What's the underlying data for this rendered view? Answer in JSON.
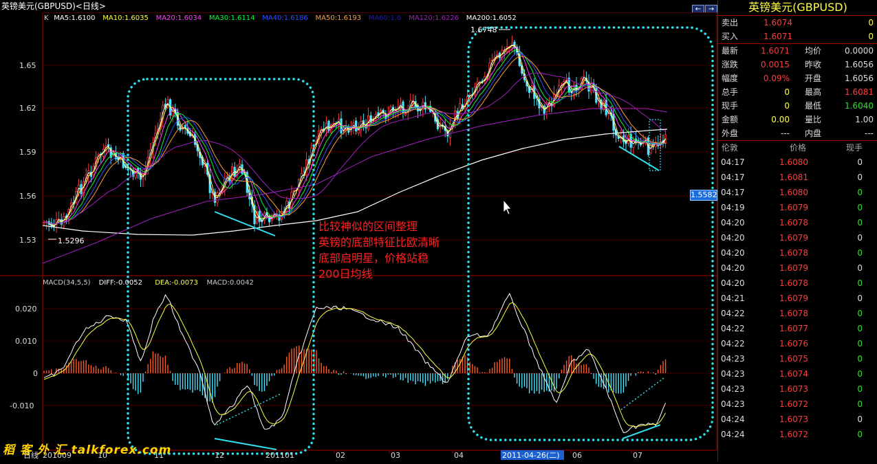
{
  "window": {
    "title": "英镑美元(GBPUSD)<日线>",
    "nav_prev": "←",
    "nav_next": "→"
  },
  "main_chart": {
    "ma_legend": [
      {
        "label": "K",
        "color": "#dddddd"
      },
      {
        "label": "MA5:1.6100",
        "color": "#ffffff"
      },
      {
        "label": "MA10:1.6035",
        "color": "#ffff40"
      },
      {
        "label": "MA20:1.6034",
        "color": "#ff40ff"
      },
      {
        "label": "MA30:1.6114",
        "color": "#00ff40"
      },
      {
        "label": "MA40:1.6186",
        "color": "#3050ff"
      },
      {
        "label": "MA50:1.6193",
        "color": "#ffa030"
      },
      {
        "label": "MA60:1.6",
        "color": "#2020a0"
      },
      {
        "label": "MA120:1.6226",
        "color": "#a020c0"
      },
      {
        "label": "MA200:1.6052",
        "color": "#ffffff"
      }
    ],
    "y_ticks": [
      "1.65",
      "1.62",
      "1.59",
      "1.56",
      "1.53"
    ],
    "high_label": "1.6748",
    "low_label": "1.5296",
    "current_price_tag": "1.5582"
  },
  "macd": {
    "header": [
      {
        "label": "MACD(34,5,5)",
        "color": "#cccccc"
      },
      {
        "label": "DIFF:-0.0052",
        "color": "#ffffff"
      },
      {
        "label": "DEA:-0.0073",
        "color": "#ffff40"
      },
      {
        "label": "MACD:0.0042",
        "color": "#cccccc"
      }
    ],
    "y_ticks": [
      "0.020",
      "0.010",
      "0",
      "-0.010"
    ]
  },
  "x_axis": {
    "labels": [
      "日线",
      "201009",
      "10",
      "11",
      "12",
      "201101",
      "02",
      "03",
      "04",
      "2011-04-26(二)",
      "06",
      "07"
    ]
  },
  "annotation": {
    "lines": [
      "比较神似的区间整理",
      "英镑的底部特征比欧清晰",
      "底部启明星，价格站稳",
      "200日均线"
    ]
  },
  "watermark": "稻 客 外 汇 talkforex.com",
  "quote_panel": {
    "title": "英镑美元(GBPUSD)",
    "rows_top": [
      {
        "label": "卖出",
        "value": "1.6074",
        "value_color": "#ff3c3c",
        "extra": "0"
      },
      {
        "label": "买入",
        "value": "1.6071",
        "value_color": "#ff3c3c",
        "extra": "0"
      }
    ],
    "rows_main": [
      {
        "l1": "最新",
        "v1": "1.6071",
        "c1": "#ff3c3c",
        "l2": "均价",
        "v2": "0.0000",
        "c2": "#dddddd"
      },
      {
        "l1": "涨跌",
        "v1": "0.0015",
        "c1": "#ff3c3c",
        "l2": "昨收",
        "v2": "1.6056",
        "c2": "#dddddd"
      },
      {
        "l1": "幅度",
        "v1": "0.09%",
        "c1": "#ff3c3c",
        "l2": "开盘",
        "v2": "1.6056",
        "c2": "#dddddd"
      },
      {
        "l1": "总手",
        "v1": "0",
        "c1": "#ffff40",
        "l2": "最高",
        "v2": "1.6081",
        "c2": "#ff3c3c"
      },
      {
        "l1": "现手",
        "v1": "0",
        "c1": "#ffff40",
        "l2": "最低",
        "v2": "1.6040",
        "c2": "#2fe02f"
      },
      {
        "l1": "金额",
        "v1": "0.00",
        "c1": "#ffff40",
        "l2": "量比",
        "v2": "1.00",
        "c2": "#dddddd"
      }
    ],
    "row_outer": {
      "l1": "外盘",
      "v1": "---",
      "l2": "内盘",
      "v2": "---"
    },
    "ticks_header": {
      "c1": "伦敦",
      "c2": "价格",
      "c3": "现手"
    },
    "ticks": [
      {
        "time": "04:17",
        "price": "1.6080",
        "vol": "0",
        "vol_color": "#dddddd"
      },
      {
        "time": "04:17",
        "price": "1.6081",
        "vol": "0",
        "vol_color": "#dddddd"
      },
      {
        "time": "04:17",
        "price": "1.6080",
        "vol": "0",
        "vol_color": "#2fe02f"
      },
      {
        "time": "04:19",
        "price": "1.6079",
        "vol": "0",
        "vol_color": "#2fe02f"
      },
      {
        "time": "04:20",
        "price": "1.6078",
        "vol": "0",
        "vol_color": "#2fe02f"
      },
      {
        "time": "04:20",
        "price": "1.6079",
        "vol": "0",
        "vol_color": "#dddddd"
      },
      {
        "time": "04:20",
        "price": "1.6078",
        "vol": "0",
        "vol_color": "#2fe02f"
      },
      {
        "time": "04:20",
        "price": "1.6079",
        "vol": "0",
        "vol_color": "#dddddd"
      },
      {
        "time": "04:20",
        "price": "1.6078",
        "vol": "0",
        "vol_color": "#2fe02f"
      },
      {
        "time": "04:21",
        "price": "1.6079",
        "vol": "0",
        "vol_color": "#dddddd"
      },
      {
        "time": "04:22",
        "price": "1.6078",
        "vol": "0",
        "vol_color": "#2fe02f"
      },
      {
        "time": "04:22",
        "price": "1.6077",
        "vol": "0",
        "vol_color": "#2fe02f"
      },
      {
        "time": "04:22",
        "price": "1.6076",
        "vol": "0",
        "vol_color": "#2fe02f"
      },
      {
        "time": "04:23",
        "price": "1.6075",
        "vol": "0",
        "vol_color": "#2fe02f"
      },
      {
        "time": "04:23",
        "price": "1.6074",
        "vol": "0",
        "vol_color": "#2fe02f"
      },
      {
        "time": "04:23",
        "price": "1.6073",
        "vol": "0",
        "vol_color": "#2fe02f"
      },
      {
        "time": "04:23",
        "price": "1.6072",
        "vol": "0",
        "vol_color": "#2fe02f"
      },
      {
        "time": "04:24",
        "price": "1.6073",
        "vol": "0",
        "vol_color": "#dddddd"
      },
      {
        "time": "04:24",
        "price": "1.6072",
        "vol": "0",
        "vol_color": "#2fe02f"
      }
    ]
  }
}
